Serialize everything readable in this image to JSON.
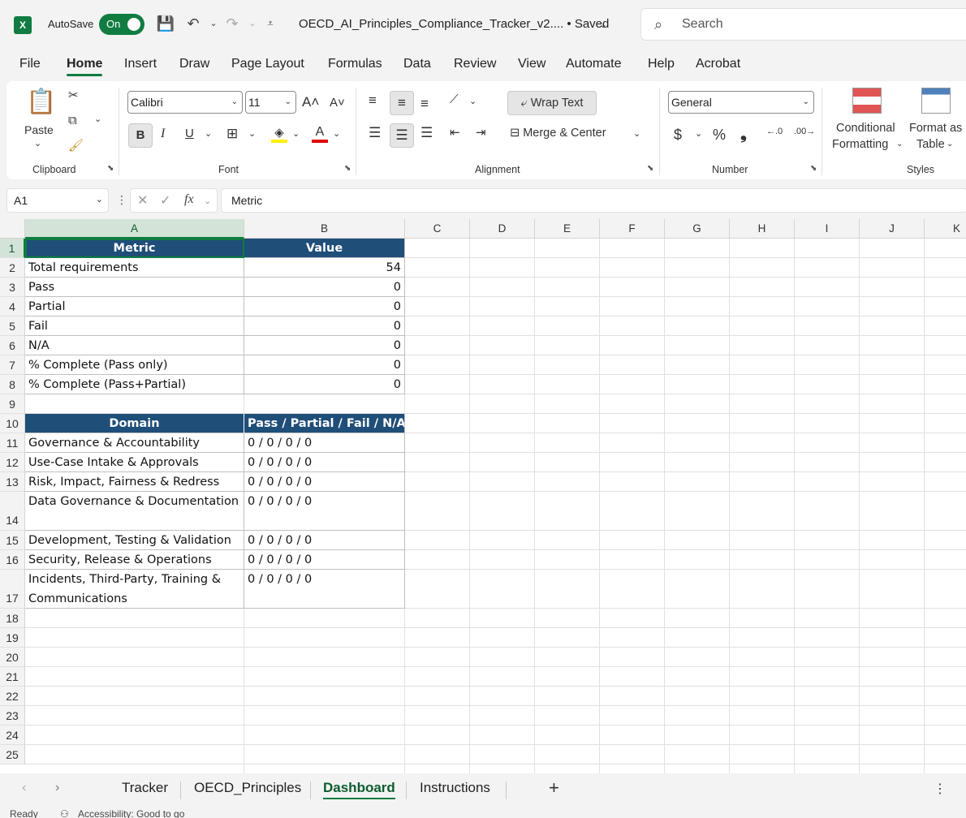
{
  "titlebar": {
    "app_icon": "X",
    "autosave_label": "AutoSave",
    "autosave_state": "On",
    "doc_title": "OECD_AI_Principles_Compliance_Tracker_v2.... • Saved",
    "search_placeholder": "Search"
  },
  "menu": [
    "File",
    "Home",
    "Insert",
    "Draw",
    "Page Layout",
    "Formulas",
    "Data",
    "Review",
    "View",
    "Automate",
    "Help",
    "Acrobat"
  ],
  "ribbon": {
    "clipboard": {
      "paste": "Paste",
      "label": "Clipboard"
    },
    "font": {
      "family": "Calibri",
      "size": "11",
      "label": "Font",
      "bold": "B",
      "italic": "I",
      "underline": "U"
    },
    "alignment": {
      "wrap_text": "Wrap Text",
      "merge_center": "Merge & Center",
      "label": "Alignment"
    },
    "number": {
      "format": "General",
      "label": "Number",
      "currency": "$",
      "percent": "%",
      "comma": "❟"
    },
    "styles": {
      "conditional": "Conditional",
      "formatting": "Formatting",
      "format_as": "Format as",
      "table": "Table",
      "label": "Styles"
    }
  },
  "formula_bar": {
    "name_box": "A1",
    "formula": "Metric"
  },
  "columns": [
    "A",
    "B",
    "C",
    "D",
    "E",
    "F",
    "G",
    "H",
    "I",
    "J",
    "K"
  ],
  "rows": [
    "1",
    "2",
    "3",
    "4",
    "5",
    "6",
    "7",
    "8",
    "9",
    "10",
    "11",
    "12",
    "13",
    "14",
    "15",
    "16",
    "17",
    "18",
    "19",
    "20",
    "21",
    "22",
    "23",
    "24",
    "25"
  ],
  "sheet": {
    "metrics_header": {
      "metric": "Metric",
      "value": "Value"
    },
    "metrics": [
      {
        "label": "Total requirements",
        "value": "54"
      },
      {
        "label": "Pass",
        "value": "0"
      },
      {
        "label": "Partial",
        "value": "0"
      },
      {
        "label": "Fail",
        "value": "0"
      },
      {
        "label": "N/A",
        "value": "0"
      },
      {
        "label": "% Complete (Pass only)",
        "value": "0"
      },
      {
        "label": "% Complete (Pass+Partial)",
        "value": "0"
      }
    ],
    "domain_header": {
      "domain": "Domain",
      "status": "Pass / Partial / Fail / N/A"
    },
    "domains": [
      {
        "label": "Governance & Accountability",
        "value": "0 / 0 / 0 / 0"
      },
      {
        "label": "Use-Case Intake & Approvals",
        "value": "0 / 0 / 0 / 0"
      },
      {
        "label": "Risk, Impact, Fairness & Redress",
        "value": "0 / 0 / 0 / 0"
      },
      {
        "label": "Data Governance & Documentation",
        "value": "0 / 0 / 0 / 0"
      },
      {
        "label": "Development, Testing & Validation",
        "value": "0 / 0 / 0 / 0"
      },
      {
        "label": "Security, Release & Operations",
        "value": "0 / 0 / 0 / 0"
      },
      {
        "label_line1": "Incidents, Third-Party, Training &",
        "label_line2": "Communications",
        "value": "0 / 0 / 0 / 0"
      }
    ]
  },
  "tabs": [
    "Tracker",
    "OECD_Principles",
    "Dashboard",
    "Instructions"
  ],
  "active_tab": "Dashboard",
  "status": {
    "ready": "Ready",
    "accessibility": "Accessibility: Good to go"
  },
  "colors": {
    "accent": "#107c41",
    "header_fill": "#1f4e79"
  }
}
